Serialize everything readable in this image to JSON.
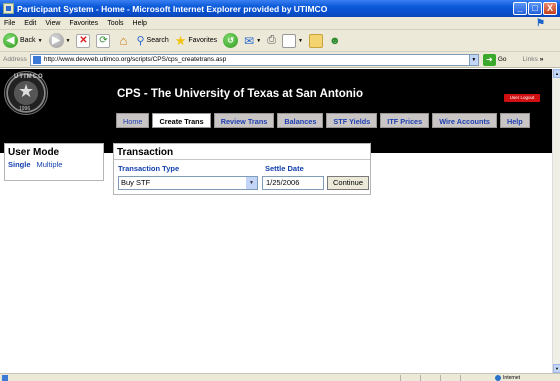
{
  "window": {
    "title": "Participant System - Home - Microsoft Internet Explorer provided by UTIMCO",
    "buttons": [
      "_",
      "□",
      "X"
    ]
  },
  "menu": [
    "File",
    "Edit",
    "View",
    "Favorites",
    "Tools",
    "Help"
  ],
  "toolbar": {
    "back_label": "Back",
    "search_label": "Search",
    "favorites_label": "Favorites"
  },
  "address": {
    "label": "Address",
    "url": "http://www.devweb.utimco.org/scripts/CPS/cps_createtrans.asp",
    "go_label": "Go",
    "links_label": "Links"
  },
  "site": {
    "title": "CPS - The University of Texas at San Antonio",
    "logout_label": "User Logout",
    "logo_top": "UTIMCO",
    "logo_bottom": "1996",
    "tabs": [
      {
        "label": "Home",
        "active": false
      },
      {
        "label": "Create Trans",
        "active": true
      },
      {
        "label": "Review Trans",
        "active": false
      },
      {
        "label": "Balances",
        "active": false
      },
      {
        "label": "STF Yields",
        "active": false
      },
      {
        "label": "ITF Prices",
        "active": false
      },
      {
        "label": "Wire Accounts",
        "active": false
      },
      {
        "label": "Help",
        "active": false
      }
    ]
  },
  "user_mode": {
    "title": "User Mode",
    "options": [
      {
        "label": "Single",
        "selected": true
      },
      {
        "label": "Multiple",
        "selected": false
      }
    ]
  },
  "transaction": {
    "title": "Transaction",
    "type_header": "Transaction Type",
    "date_header": "Settle Date",
    "type_value": "Buy STF",
    "date_value": "1/25/2006",
    "continue_label": "Continue"
  },
  "status": {
    "zone": "Internet"
  },
  "colors": {
    "titlebar": "#0a58d8",
    "header_bg": "#000000",
    "tab_bg": "#c9c5c4",
    "link": "#123fae",
    "logout": "#d01010"
  }
}
